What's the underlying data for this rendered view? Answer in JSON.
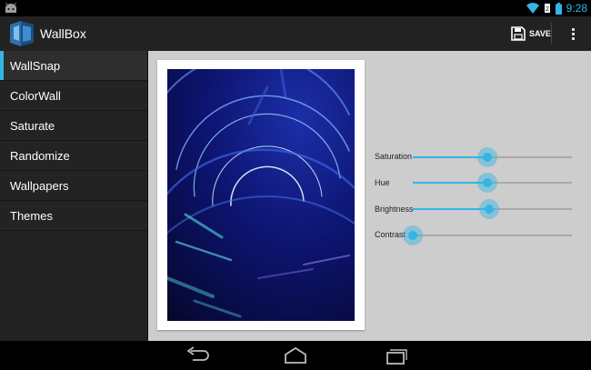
{
  "status_bar": {
    "time": "9:28"
  },
  "action_bar": {
    "title": "WallBox",
    "save_label": "SAVE"
  },
  "drawer": {
    "items": [
      {
        "label": "WallSnap",
        "active": true
      },
      {
        "label": "ColorWall",
        "active": false
      },
      {
        "label": "Saturate",
        "active": false
      },
      {
        "label": "Randomize",
        "active": false
      },
      {
        "label": "Wallpapers",
        "active": false
      },
      {
        "label": "Themes",
        "active": false
      }
    ]
  },
  "sliders": [
    {
      "label": "Saturation",
      "value": 0.47
    },
    {
      "label": "Hue",
      "value": 0.47
    },
    {
      "label": "Brightness",
      "value": 0.48
    },
    {
      "label": "Contrast",
      "value": 0.0
    }
  ],
  "colors": {
    "accent": "#33b5e5",
    "action_bar": "#222222",
    "drawer": "#232323",
    "content_bg": "#cdcdcd"
  }
}
